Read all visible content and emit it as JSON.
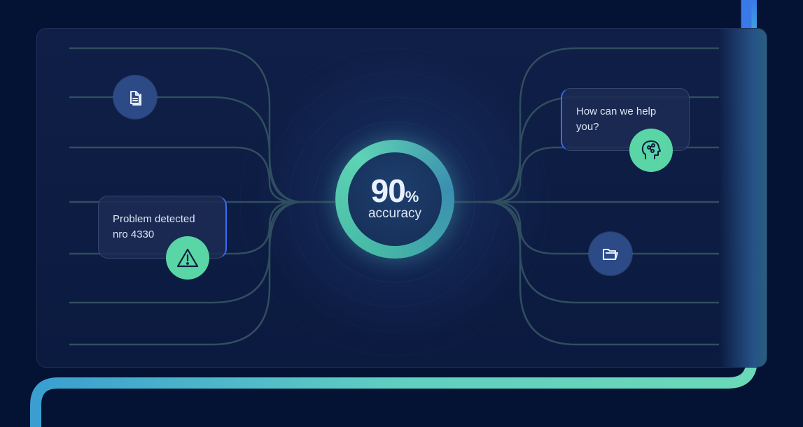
{
  "metric": {
    "value": "90",
    "unit": "%",
    "label": "accuracy"
  },
  "cards": {
    "problem": {
      "line1": "Problem detected",
      "line2": "nro 4330"
    },
    "help": {
      "line1": "How can we help",
      "line2": "you?"
    }
  },
  "icons": {
    "left_top": "document-icon",
    "left_card": "warning-icon",
    "right_card": "ai-brain-icon",
    "right_bottom": "folder-icon"
  },
  "colors": {
    "background": "#041233",
    "panel": "#0f1f47",
    "accent_teal": "#5ad6a6",
    "accent_blue": "#3b6cf0",
    "icon_blue": "#2c4a86"
  }
}
